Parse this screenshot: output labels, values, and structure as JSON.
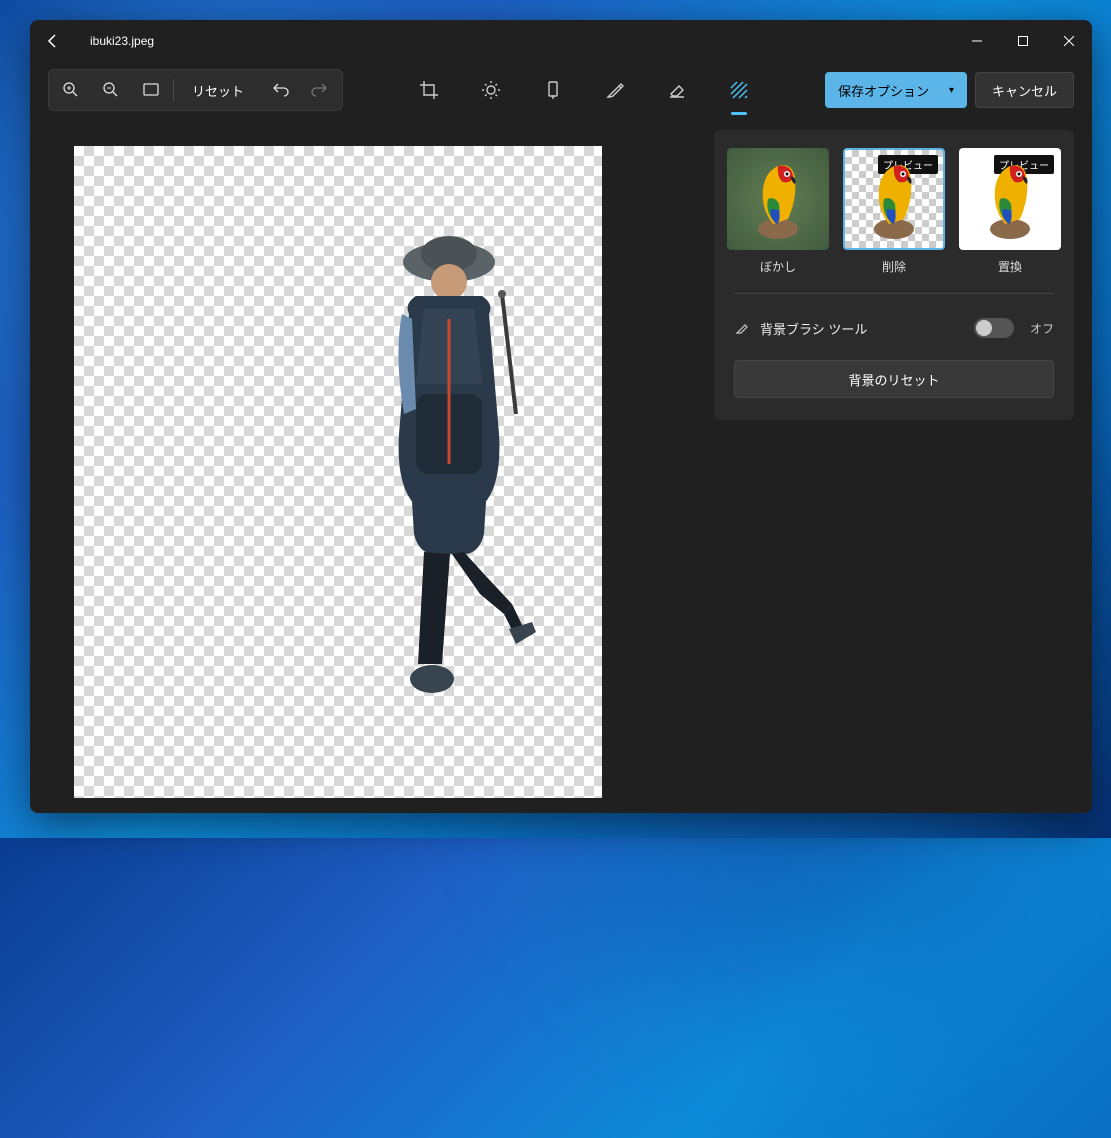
{
  "titlebar": {
    "filename": "ibuki23.jpeg"
  },
  "toolbar": {
    "reset_label": "リセット",
    "save_options_label": "保存オプション",
    "cancel_label": "キャンセル"
  },
  "panel": {
    "thumbs": [
      {
        "label": "ぼかし",
        "badge": "",
        "selected": false,
        "bg": "blur-bg"
      },
      {
        "label": "削除",
        "badge": "プレビュー",
        "selected": true,
        "bg": "trans-bg"
      },
      {
        "label": "置換",
        "badge": "プレビュー",
        "selected": false,
        "bg": "white-bg"
      }
    ],
    "brush_tool_label": "背景ブラシ ツール",
    "toggle_state_label": "オフ",
    "reset_bg_label": "背景のリセット"
  }
}
